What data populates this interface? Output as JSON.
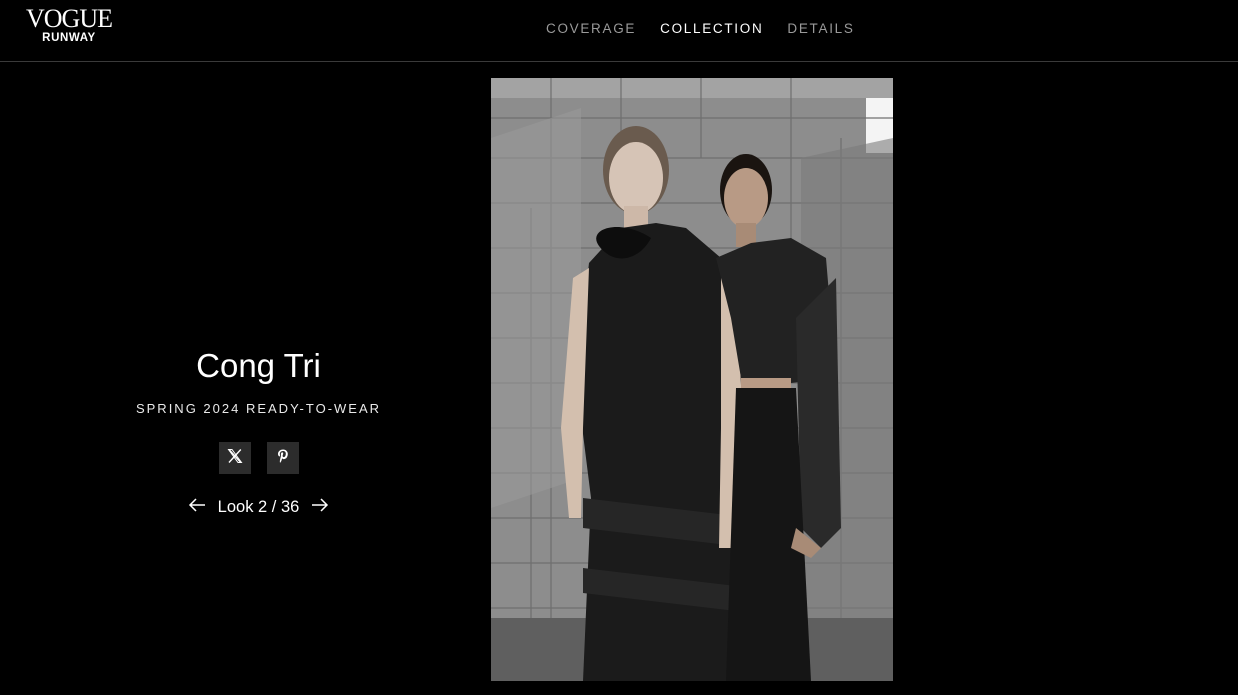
{
  "logo": {
    "title": "VOGUE",
    "subtitle": "RUNWAY"
  },
  "nav": {
    "items": [
      {
        "label": "COVERAGE",
        "active": false
      },
      {
        "label": "COLLECTION",
        "active": true
      },
      {
        "label": "DETAILS",
        "active": false
      }
    ]
  },
  "show": {
    "designer": "Cong Tri",
    "season": "SPRING 2024 READY-TO-WEAR"
  },
  "share": {
    "icons": [
      "x-icon",
      "pinterest-icon"
    ]
  },
  "pager": {
    "label": "Look 2 / 36",
    "current": 2,
    "total": 36
  },
  "colors": {
    "background": "#000000",
    "text": "#ffffff",
    "nav_inactive": "#9a9a9a",
    "share_button": "#2c2c2c"
  }
}
